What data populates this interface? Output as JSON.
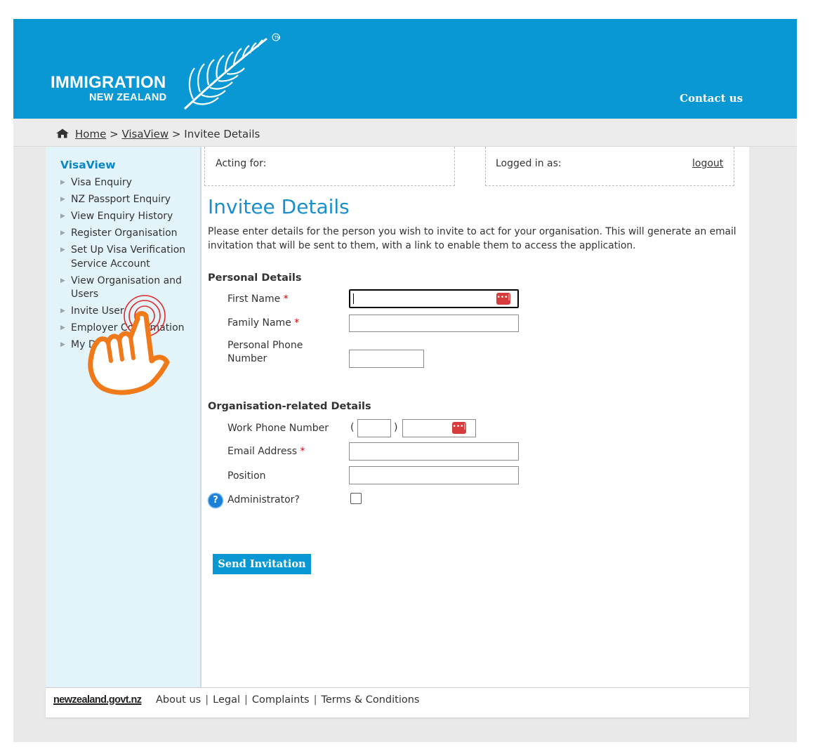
{
  "header": {
    "logo_line1": "IMMIGRATION",
    "logo_line2": "NEW ZEALAND",
    "contact_label": "Contact us",
    "brand_color": "#0998d4"
  },
  "breadcrumb": {
    "home_icon": "home-icon",
    "home": "Home",
    "sep1": ">",
    "visaview": "VisaView",
    "sep2": ">",
    "current": "Invitee Details"
  },
  "sidebar": {
    "title": "VisaView",
    "items": [
      {
        "label": "Visa Enquiry"
      },
      {
        "label": "NZ Passport Enquiry"
      },
      {
        "label": "View Enquiry History"
      },
      {
        "label": "Register Organisation"
      },
      {
        "label": "Set Up Visa Verification Service Account"
      },
      {
        "label": "View Organisation and Users"
      },
      {
        "label": "Invite User"
      },
      {
        "label": "Employer Confirmation"
      },
      {
        "label": "My D"
      }
    ]
  },
  "session": {
    "acting_for_label": "Acting for:",
    "logged_in_label": "Logged in as:",
    "logout_label": "logout"
  },
  "form": {
    "title": "Invitee Details",
    "intro": "Please enter details for the person you wish to invite to act for your organisation. This will generate an email invitation that will be sent to them, with a link to enable them to access the application.",
    "personal_heading": "Personal Details",
    "first_name_label": "First Name",
    "family_name_label": "Family Name",
    "personal_phone_label_1": "Personal Phone",
    "personal_phone_label_2": "Number",
    "org_heading": "Organisation-related Details",
    "work_phone_label": "Work Phone Number",
    "paren_open": "(",
    "paren_close": ")",
    "email_label": "Email Address",
    "position_label": "Position",
    "admin_label": "Administrator?",
    "required_mark": "*",
    "help_glyph": "?",
    "password_manager_icon": "password-manager-icon",
    "password_manager_glyph": "•••|",
    "send_button": "Send Invitation",
    "administrator_checked": false
  },
  "footer": {
    "logo": "newzealand.govt.nz",
    "links": [
      "About us",
      "Legal",
      "Complaints",
      "Terms & Conditions"
    ],
    "separator": "|"
  },
  "overlay": {
    "icon": "pointing-hand-icon",
    "color": "#f07a1a"
  }
}
